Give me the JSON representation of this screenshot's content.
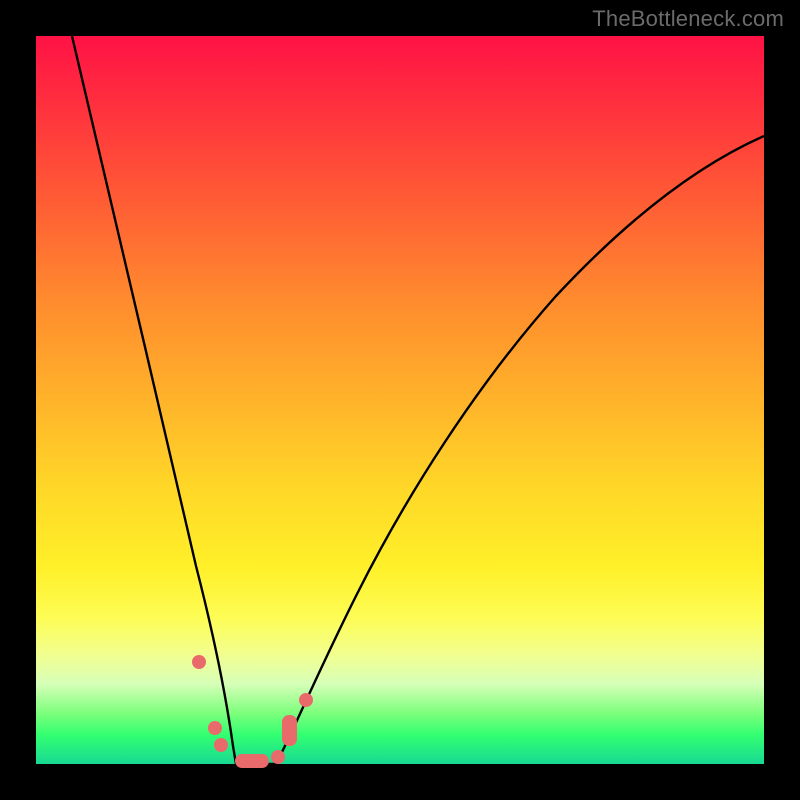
{
  "watermark": "TheBottleneck.com",
  "colors": {
    "gradient_top": "#ff1245",
    "gradient_bottom": "#18d993",
    "curve": "#000000",
    "marker": "#e96a6a",
    "frame": "#000000"
  },
  "chart_data": {
    "type": "line",
    "title": "",
    "xlabel": "",
    "ylabel": "",
    "xlim": [
      0,
      100
    ],
    "ylim": [
      0,
      100
    ],
    "grid": false,
    "note": "Tick labels are not visible; values are positional estimates (arbitrary 0–100 units).",
    "series": [
      {
        "name": "left-branch",
        "x": [
          5,
          8,
          11,
          14,
          17,
          20,
          22,
          24,
          25.5,
          27
        ],
        "y": [
          100,
          84,
          68,
          52,
          37,
          23,
          13,
          6,
          2,
          0
        ]
      },
      {
        "name": "valley-floor",
        "x": [
          27,
          28.5,
          30,
          31.5,
          33
        ],
        "y": [
          0,
          0,
          0,
          0,
          0
        ]
      },
      {
        "name": "right-branch",
        "x": [
          33,
          35,
          38,
          42,
          47,
          53,
          60,
          68,
          77,
          87,
          98
        ],
        "y": [
          0,
          3,
          8,
          16,
          26,
          37,
          48,
          59,
          69,
          78,
          86
        ]
      }
    ],
    "markers": [
      {
        "shape": "circle",
        "x": 22.3,
        "y": 14.0
      },
      {
        "shape": "circle",
        "x": 24.6,
        "y": 5.0
      },
      {
        "shape": "circle",
        "x": 25.4,
        "y": 2.6
      },
      {
        "shape": "pill",
        "x": 29.6,
        "y": 0.4,
        "w": 4.6,
        "h": 1.9
      },
      {
        "shape": "circle",
        "x": 33.2,
        "y": 1.0
      },
      {
        "shape": "pill",
        "x": 34.8,
        "y": 4.6,
        "w": 2.0,
        "h": 4.2
      },
      {
        "shape": "circle",
        "x": 37.1,
        "y": 8.8
      }
    ]
  }
}
